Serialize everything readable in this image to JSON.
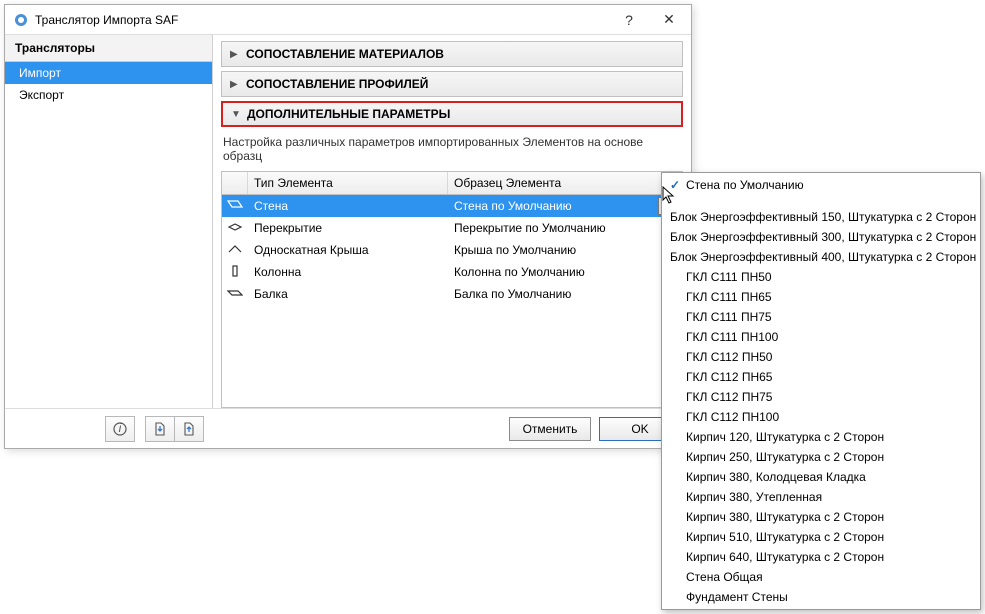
{
  "window": {
    "title": "Транслятор Импорта SAF"
  },
  "sidebar": {
    "header": "Трансляторы",
    "items": [
      {
        "label": "Импорт",
        "selected": true
      },
      {
        "label": "Экспорт",
        "selected": false
      }
    ]
  },
  "sections": {
    "materials": "СОПОСТАВЛЕНИЕ МАТЕРИАЛОВ",
    "profiles": "СОПОСТАВЛЕНИЕ ПРОФИЛЕЙ",
    "extras": "ДОПОЛНИТЕЛЬНЫЕ ПАРАМЕТРЫ",
    "desc": "Настройка различных параметров импортированных Элементов на основе образц"
  },
  "grid": {
    "col_type": "Тип Элемента",
    "col_sample": "Образец Элемента",
    "rows": [
      {
        "type": "Стена",
        "sample": "Стена по Умолчанию",
        "selected": true
      },
      {
        "type": "Перекрытие",
        "sample": "Перекрытие по Умолчанию",
        "selected": false
      },
      {
        "type": "Односкатная Крыша",
        "sample": "Крыша по Умолчанию",
        "selected": false
      },
      {
        "type": "Колонна",
        "sample": "Колонна по Умолчанию",
        "selected": false
      },
      {
        "type": "Балка",
        "sample": "Балка по Умолчанию",
        "selected": false
      }
    ]
  },
  "buttons": {
    "cancel": "Отменить",
    "ok": "OK"
  },
  "dropdown": {
    "selected": "Стена по Умолчанию",
    "items": [
      "Блок Энергоэффективный 150, Штукатурка с 2 Сторон",
      "Блок Энергоэффективный 300, Штукатурка с 2 Сторон",
      "Блок Энергоэффективный 400, Штукатурка с 2 Сторон",
      "ГКЛ С111 ПН50",
      "ГКЛ С111 ПН65",
      "ГКЛ С111 ПН75",
      "ГКЛ С111 ПН100",
      "ГКЛ С112 ПН50",
      "ГКЛ С112 ПН65",
      "ГКЛ С112 ПН75",
      "ГКЛ С112 ПН100",
      "Кирпич 120, Штукатурка с 2 Сторон",
      "Кирпич 250, Штукатурка с 2 Сторон",
      "Кирпич 380, Колодцевая Кладка",
      "Кирпич 380, Утепленная",
      "Кирпич 380, Штукатурка с 2 Сторон",
      "Кирпич 510, Штукатурка с 2 Сторон",
      "Кирпич 640, Штукатурка с 2 Сторон",
      "Стена Общая",
      "Фундамент Стены"
    ]
  }
}
